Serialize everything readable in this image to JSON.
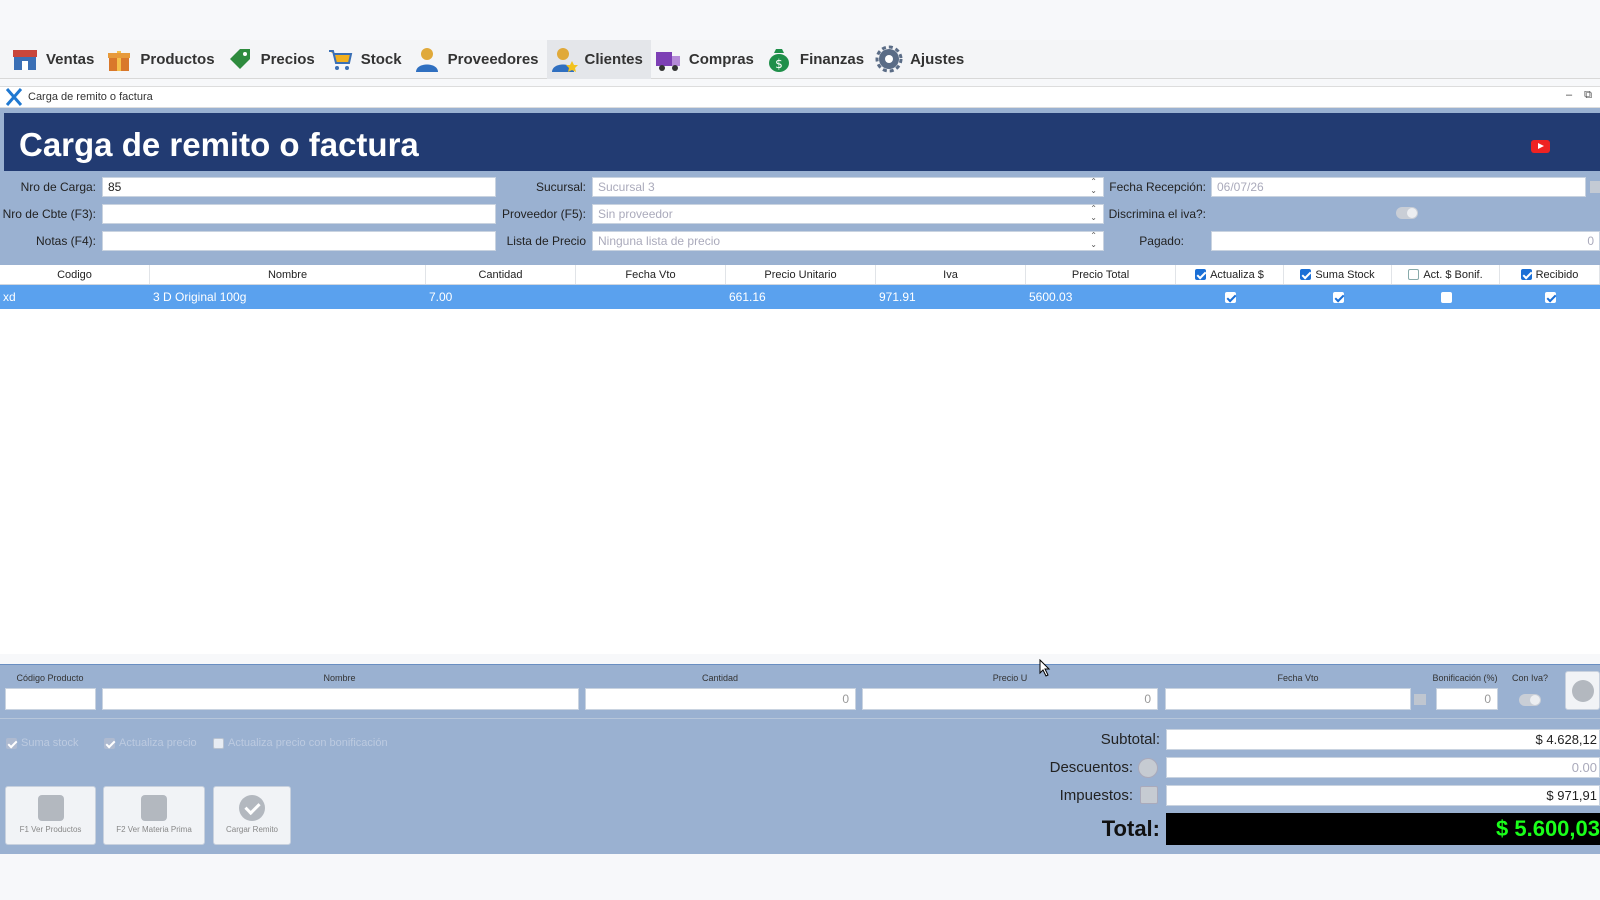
{
  "menu": {
    "items": [
      {
        "label": "Ventas",
        "icon": "store-icon",
        "color": "#c8463b"
      },
      {
        "label": "Productos",
        "icon": "gift-icon",
        "color": "#d9782b"
      },
      {
        "label": "Precios",
        "icon": "price-tag-icon",
        "color": "#2e8b3e"
      },
      {
        "label": "Stock",
        "icon": "cart-icon",
        "color": "#f2b01e"
      },
      {
        "label": "Proveedores",
        "icon": "supplier-person-icon",
        "color": "#2f6fc0"
      },
      {
        "label": "Clientes",
        "icon": "client-person-icon",
        "color": "#e0a93a"
      },
      {
        "label": "Compras",
        "icon": "truck-icon",
        "color": "#7d3fb5"
      },
      {
        "label": "Finanzas",
        "icon": "money-bag-icon",
        "color": "#1f8f4a"
      },
      {
        "label": "Ajustes",
        "icon": "gear-icon",
        "color": "#5a6c86"
      }
    ]
  },
  "window": {
    "title": "Carga de remito o factura",
    "minimize": "–",
    "restore": "⧉"
  },
  "form": {
    "banner_title": "Carga de remito o factura",
    "nro_carga_label": "Nro de Carga:",
    "nro_carga_value": "85",
    "nro_cbte_label": "Nro de Cbte (F3):",
    "nro_cbte_value": "",
    "notas_label": "Notas (F4):",
    "notas_value": "",
    "sucursal_label": "Sucursal:",
    "sucursal_value": "Sucursal 3",
    "proveedor_label": "Proveedor (F5):",
    "proveedor_value": "Sin proveedor",
    "lista_label": "Lista de Precio",
    "lista_value": "Ninguna lista de precio",
    "fecha_label": "Fecha Recepción:",
    "fecha_value": "06/07/26",
    "discrimina_label": "Discrimina el iva?:",
    "pagado_label": "Pagado:",
    "pagado_value": "0"
  },
  "grid": {
    "columns": [
      "Codigo",
      "Nombre",
      "Cantidad",
      "Fecha Vto",
      "Precio Unitario",
      "Iva",
      "Precio Total",
      "Actualiza $",
      "Suma Stock",
      "Act. $ Bonif.",
      "Recibido"
    ],
    "header_checks": [
      true,
      true,
      false,
      true
    ],
    "rows": [
      {
        "codigo": "xd",
        "nombre": "3 D Original 100g",
        "cantidad": "7.00",
        "fecha_vto": "",
        "precio_unitario": "661.16",
        "iva": "971.91",
        "precio_total": "5600.03",
        "checks": [
          true,
          true,
          false,
          true
        ]
      }
    ]
  },
  "entry": {
    "labels": {
      "codigo": "Código Producto",
      "nombre": "Nombre",
      "cantidad": "Cantidad",
      "precio": "Precio U",
      "fecha": "Fecha Vto",
      "bonif": "Bonificación (%)",
      "coniva": "Con Iva?"
    },
    "cantidad_value": "0",
    "precio_value": "0",
    "bonif_value": "0"
  },
  "options": [
    {
      "label": "Suma stock",
      "checked": true
    },
    {
      "label": "Actualiza precio",
      "checked": true
    },
    {
      "label": "Actualiza precio con bonificación",
      "checked": false
    }
  ],
  "buttons": {
    "ver_productos": "F1 Ver Productos",
    "ver_materia": "F2 Ver Materia Prima",
    "cargar_remito": "Cargar Remito"
  },
  "totals": {
    "subtotal_label": "Subtotal:",
    "subtotal_value": "$ 4.628,12",
    "descuentos_label": "Descuentos:",
    "descuentos_value": "0.00",
    "impuestos_label": "Impuestos:",
    "impuestos_value": "$ 971,91",
    "total_label": "Total:",
    "total_value": "$ 5.600,03"
  }
}
